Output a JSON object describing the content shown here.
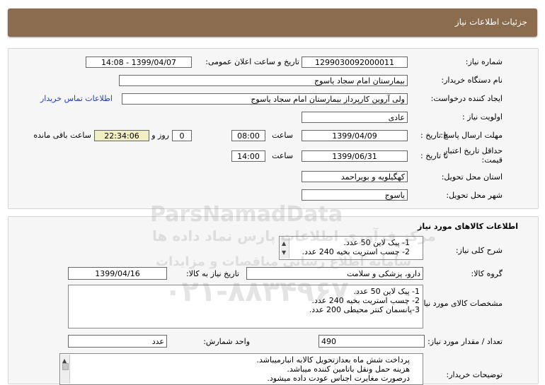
{
  "header": {
    "title": "جزئیات اطلاعات نیاز"
  },
  "need_info": {
    "need_number_label": "شماره نیاز:",
    "need_number": "1299030092000011",
    "announce_label": "تاریخ و ساعت اعلان عمومی:",
    "announce_value": "1399/04/07 - 14:08",
    "buyer_label": "نام دستگاه خریدار:",
    "buyer_value": "بیمارستان امام سجاد یاسوج",
    "creator_label": "ایجاد کننده درخواست:",
    "creator_value": "ولی آروین کارپرداز بیمارستان امام سجاد یاسوج",
    "contact_link": "اطلاعات تماس خریدار",
    "priority_label": "اولویت نیاز :",
    "priority_value": "عادی",
    "deadline_label": "مهلت ارسال پاسخ:",
    "to_date_label": "تا تاریخ :",
    "deadline_date": "1399/04/09",
    "time_label": "ساعت",
    "deadline_time": "08:00",
    "days_value": "0",
    "days_label": "روز و",
    "remaining_time": "22:34:06",
    "remaining_label": "ساعت باقی مانده",
    "validity_label": "حداقل تاریخ اعتبار قیمت:",
    "validity_to_label": "تا تاریخ :",
    "validity_date": "1399/06/31",
    "validity_time_label": "ساعت",
    "validity_time": "14:00",
    "province_label": "استان محل تحویل:",
    "province_value": "کهگیلویه و بویراحمد",
    "city_label": "شهر محل تحویل:",
    "city_value": "یاسوج"
  },
  "goods": {
    "section_title": "اطلاعات کالاهای مورد نیاز",
    "summary_label": "شرح کلی نیاز:",
    "summary_lines": [
      "1- پیک لاین 50 عدد.",
      "2- چسب استریت بخیه 240 عدد."
    ],
    "group_label": "گروه کالا:",
    "group_value": "دارو، پزشکی و سلامت",
    "need_date_label": "تاریخ نیاز به کالا:",
    "need_date_value": "1399/04/16",
    "spec_label": "مشخصات کالای مورد نیاز:",
    "spec_lines": [
      "1- پیک لاین 50 عدد.",
      "2- چسب استریت بخیه 240 عدد.",
      "3-پانسمان کنتر محیطی 200 عدد."
    ],
    "qty_label": "تعداد / مقدار مورد نیاز:",
    "qty_value": "490",
    "unit_label": "واحد شمارش:",
    "unit_value": "عدد",
    "notes_label": "توضیحات خریدار:",
    "notes_lines": [
      "پرداخت شش ماه بعدازتحویل کالابه انبارمیباشد.",
      "هزینه حمل ونقل باتامین کننده میباشد.",
      "درصورت مغایرت اجناس عودت داده میشود."
    ]
  },
  "watermark": {
    "brand": "ParsNamadData",
    "slogan": "مرکز فرآوری اطلاعات پارس نماد داده ها",
    "slogan2": "سامانه اطلاع رسانی مناقصات و مزایدات",
    "phone": "۰۲۱-۸۸۳۴۹۶۷۰"
  }
}
